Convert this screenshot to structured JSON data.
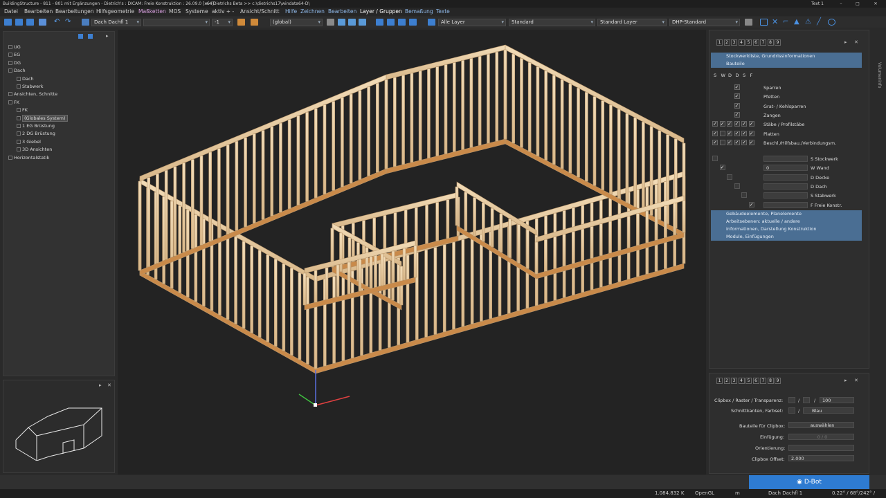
{
  "titlebar": {
    "title": "BuildingStructure - 811 - 801 mit Ergänzungen - Dietrich's : DICAM: Freie Konstruktion : 26.09.0 [x64]",
    "path": "<< Dietrichs Beta >> c:\\dietrichs17\\windata64-D\\",
    "right_label": "Text 1"
  },
  "menu": {
    "items": [
      "Datei",
      "Bearbeiten",
      "Bearbeitungen",
      "Hilfsgeometrie",
      "Maßketten",
      "MOS",
      "Systeme",
      "aktiv + -",
      "Ansicht/Schnitt",
      "Hilfe",
      "Zeichnen",
      "Bearbeiten",
      "Layer / Gruppen",
      "Bemaßung",
      "Texte"
    ]
  },
  "toolbar": {
    "dach": "Dach Dachfl 1",
    "minus1": "-1",
    "global": "(global)",
    "layer": "Alle Layer",
    "standard": "Standard",
    "std_layer": "Standard Layer",
    "dhp": "DHP-Standard"
  },
  "tree": [
    {
      "label": "UG",
      "indent": 0
    },
    {
      "label": "EG",
      "indent": 0
    },
    {
      "label": "DG",
      "indent": 0
    },
    {
      "label": "Dach",
      "indent": 0
    },
    {
      "label": "Dach",
      "indent": 1
    },
    {
      "label": "Stabwerk",
      "indent": 1
    },
    {
      "label": "Ansichten, Schnitte",
      "indent": 0
    },
    {
      "label": "FK",
      "indent": 0
    },
    {
      "label": "FK",
      "indent": 1
    },
    {
      "label": "(Globales System)",
      "indent": 1
    },
    {
      "label": "1 EG Brüstung",
      "indent": 1
    },
    {
      "label": "2 DG Brüstung",
      "indent": 1
    },
    {
      "label": "3 Giebel",
      "indent": 1
    },
    {
      "label": "3D Ansichten",
      "indent": 1
    },
    {
      "label": "Horizontalstatik",
      "indent": 0
    }
  ],
  "rightpanel": {
    "tabs": [
      "1",
      "2",
      "3",
      "4",
      "5",
      "6",
      "7",
      "8",
      "9"
    ],
    "sections_top": [
      "Stockwerkliste, Grundrissinformationen",
      "Bauteile"
    ],
    "col_headers": [
      "S",
      "W",
      "D",
      "D",
      "S",
      "F"
    ],
    "bauteile": [
      "Sparren",
      "Pfetten",
      "Grat- / Kehlsparren",
      "Zangen",
      "Stäbe / Profilstäbe",
      "Platten",
      "Beschl./Hilfsbau./Verbindungsm."
    ],
    "stockwerk": [
      "S Stockwerk",
      "W Wand",
      "D Decke",
      "D Dach",
      "S Stabwerk",
      "F Freie Konstr."
    ],
    "wand_value": "0",
    "sections_bottom": [
      "Gebäudeelemente, Planelemente",
      "Arbeitsebenen: aktuelle / andere",
      "Informationen, Darstellung Konstruktion",
      "Module, Einfügungen"
    ]
  },
  "clip": {
    "tabs": [
      "1",
      "2",
      "3",
      "4",
      "5",
      "6",
      "7",
      "8",
      "9"
    ],
    "clipbox_label": "Clipbox / Raster / Transparenz:",
    "transparency": "100",
    "schnitt_label": "Schnittkanten, Farbset:",
    "farbset": "Blau",
    "bauteile_label": "Bauteile für Clipbox:",
    "bauteile_btn": "auswählen",
    "einfuegung_label": "Einfügung:",
    "einfuegung_val": "0 / 0",
    "orientierung_label": "Orientierung:",
    "offset_label": "Clipbox Offset:",
    "offset_val": "2.000"
  },
  "sidetab": "Volumeninfo",
  "dbot": "D-Bot",
  "status": {
    "coords": "1.084.832 K",
    "renderer": "OpenGL",
    "unit": "m",
    "layer": "Dach Dachfl 1",
    "angles": "0.22° / 68°/242° /"
  }
}
